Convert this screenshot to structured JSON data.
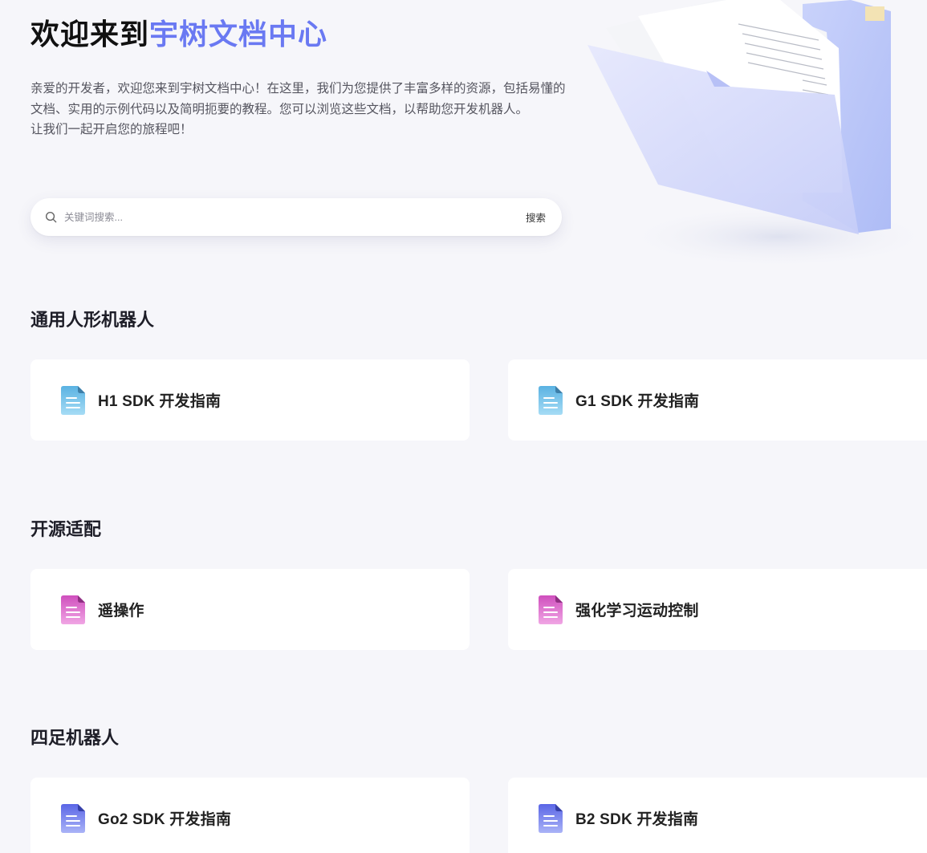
{
  "hero": {
    "title_prefix": "欢迎来到",
    "title_accent": "宇树文档中心",
    "description_line1": "亲爱的开发者，欢迎您来到宇树文档中心！在这里，我们为您提供了丰富多样的资源，包括易懂的文档、实用的示例代码以及简明扼要的教程。您可以浏览这些文档，以帮助您开发机器人。",
    "description_line2": "让我们一起开启您的旅程吧！"
  },
  "search": {
    "placeholder": "关键词搜索...",
    "button_label": "搜索"
  },
  "colors": {
    "accent": "#6a79f2",
    "background": "#f6f6fa",
    "blue_doc_icon": "#5fb7e4",
    "pink_doc_icon": "#d35fc2",
    "purple_doc_icon": "#6675ea"
  },
  "sections": [
    {
      "title": "通用人形机器人",
      "icon": "document-icon-blue",
      "cards": [
        {
          "label": "H1 SDK 开发指南"
        },
        {
          "label": "G1 SDK 开发指南"
        }
      ]
    },
    {
      "title": "开源适配",
      "icon": "document-icon-pink",
      "cards": [
        {
          "label": "遥操作"
        },
        {
          "label": "强化学习运动控制"
        }
      ]
    },
    {
      "title": "四足机器人",
      "icon": "document-icon-purple",
      "cards": [
        {
          "label": "Go2 SDK 开发指南"
        },
        {
          "label": "B2 SDK 开发指南"
        }
      ]
    }
  ]
}
